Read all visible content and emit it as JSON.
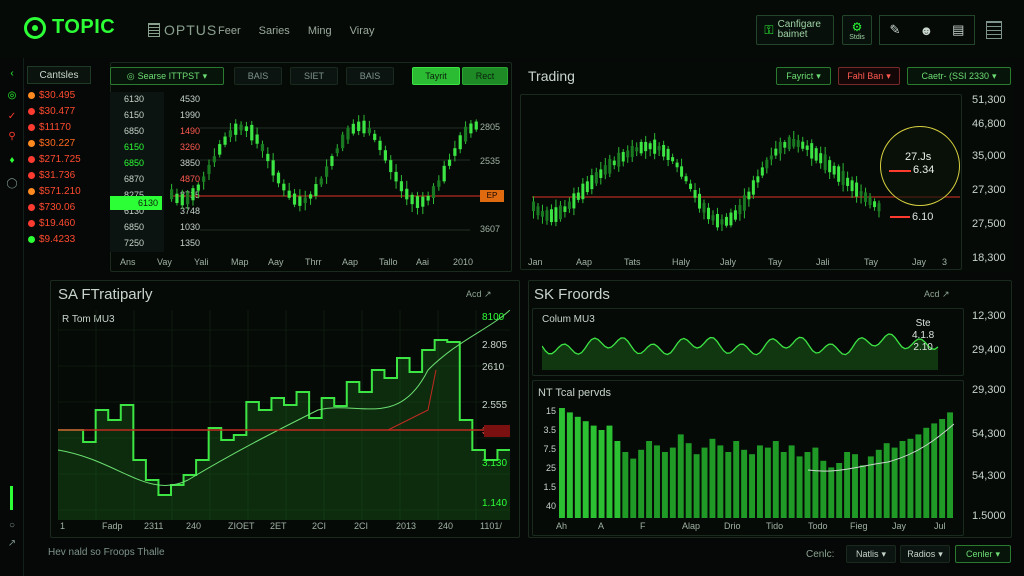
{
  "app": {
    "logo_text": "TOPIC",
    "brand2": "OPTUS",
    "nav": [
      "Feer",
      "Saries",
      "Ming",
      "Viray"
    ],
    "configure_label": "Canfigare baimet",
    "settings_icon_label": "Stdis"
  },
  "watchlist": {
    "title": "Cantsles",
    "rows": [
      {
        "value": "$30.495",
        "color": "#ff4a30"
      },
      {
        "value": "$30.477",
        "color": "#ff4a30"
      },
      {
        "value": "$11170",
        "color": "#ff4a30"
      },
      {
        "value": "$30.227",
        "color": "#ff6a20"
      },
      {
        "value": "$271.725",
        "color": "#ff4a30"
      },
      {
        "value": "$31.736",
        "color": "#ff4a30"
      },
      {
        "value": "$571.210",
        "color": "#ff4a30"
      },
      {
        "value": "$730.06",
        "color": "#ff4a30"
      },
      {
        "value": "$19.460",
        "color": "#ff4a30"
      },
      {
        "value": "$9.4233",
        "color": "#ff4a30"
      }
    ]
  },
  "chart1": {
    "series_select": "Searse ITTPST",
    "tabs": [
      "BAIS",
      "SIET",
      "BAIS"
    ],
    "toggle_on": "Tayrit",
    "toggle_on2": "Rect",
    "price_col_a": [
      "6130",
      "6150",
      "6850",
      "6150",
      "6850",
      "6870",
      "8275",
      "6130",
      "6850",
      "7250"
    ],
    "price_col_b": [
      "4530",
      "1990",
      "1490",
      "3260",
      "3850",
      "4870",
      "8715",
      "3748",
      "1030",
      "1350"
    ],
    "highlight_row": "6130",
    "right_ticks": [
      "2805",
      "2535",
      "3607"
    ],
    "marker": "EP",
    "x_labels": [
      "Ans",
      "Vay",
      "Yali",
      "Map",
      "Aay",
      "Thrr",
      "Aap",
      "Tallo",
      "Aai",
      "2010"
    ]
  },
  "chart2": {
    "title": "Trading",
    "select1": "Fayrict",
    "select2": "Fahl Ban",
    "select3": "Caetr- (SSI 2330",
    "right_ticks": [
      "51,300",
      "46,800",
      "35,000",
      "27,300",
      "27,500",
      "18,300"
    ],
    "circle_value1": "27.Js",
    "circle_value2": "6.34",
    "annotation": "6.10",
    "x_labels": [
      "Jan",
      "Aap",
      "Tats",
      "Haly",
      "Jaly",
      "Tay",
      "Jali",
      "Tay",
      "Jay"
    ],
    "x_last": "3"
  },
  "chart3": {
    "title": "SA FTratiparly",
    "corner": "Acd",
    "subtitle": "R Tom MU3",
    "right_labels": [
      "8100",
      "2.805",
      "2610",
      "2.555",
      "3.40",
      "3.130",
      "1.140"
    ],
    "x_labels": [
      "1",
      "Fadp",
      "2311",
      "240",
      "ZIOET",
      "2ET",
      "2CI",
      "2CI",
      "2013",
      "240",
      "1101/"
    ],
    "footer": "Hev nald so Froops Thalle"
  },
  "chart4": {
    "title": "SK Froords",
    "corner": "Acd",
    "sub1": "Colum MU3",
    "sub1_vals": [
      "Ste",
      "4.1.8",
      "2.10"
    ],
    "sub2": "NT Tcal pervds",
    "y_ticks": [
      "15",
      "3.5",
      "7.5",
      "25",
      "1.5",
      "40"
    ],
    "x_labels": [
      "Ah",
      "A",
      "F",
      "Alap",
      "Drio",
      "Tido",
      "Todo",
      "Fieg",
      "Jay",
      "Jul"
    ],
    "right_ticks": [
      "12,300",
      "29,400",
      "29,300",
      "54,300",
      "54,300",
      "1.5000"
    ],
    "footer_label": "Cenlc:",
    "footer_buttons": [
      "Natlis",
      "Radios",
      "Cenler"
    ]
  }
}
